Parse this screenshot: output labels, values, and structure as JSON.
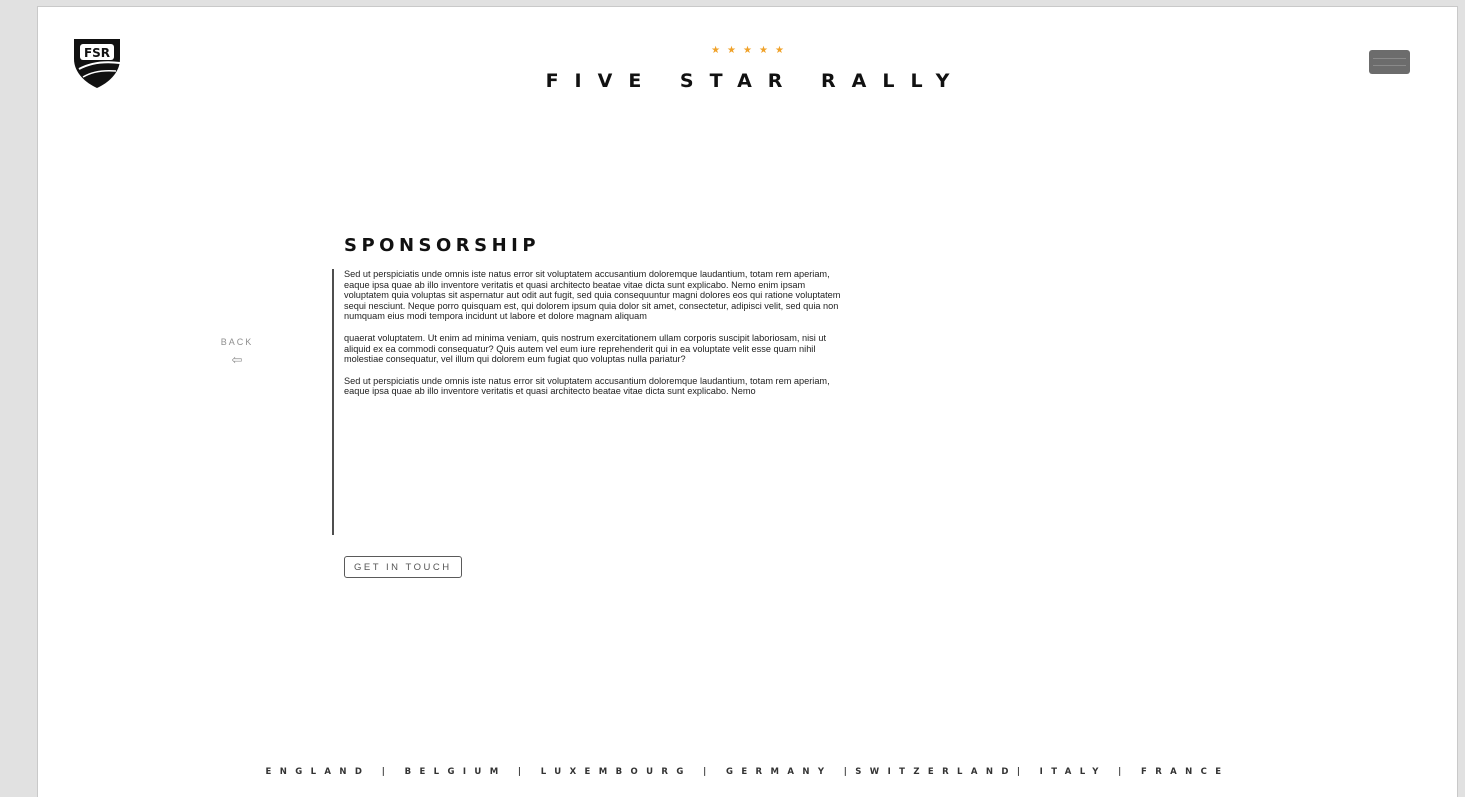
{
  "header": {
    "logo_text": "FSR",
    "stars": "★★★★★",
    "brand_title": "FIVE STAR RALLY",
    "menu_icon": "hamburger-menu-icon"
  },
  "colors": {
    "accent_star": "#f0a22a",
    "page_background": "#ffffff",
    "outer_background": "#e1e1e1",
    "menu_button": "#6c6c6c"
  },
  "nav": {
    "back_label": "BACK",
    "back_arrow": "⇦"
  },
  "main": {
    "title": "SPONSORSHIP",
    "paragraphs": [
      "Sed ut perspiciatis unde omnis iste natus error sit voluptatem accusantium doloremque laudantium, totam rem aperiam, eaque ipsa quae ab illo inventore veritatis et quasi architecto beatae vitae dicta sunt explicabo. Nemo enim ipsam voluptatem quia voluptas sit aspernatur aut odit aut fugit, sed quia consequuntur magni dolores eos qui ratione voluptatem sequi nesciunt. Neque porro quisquam est, qui dolorem ipsum quia dolor sit amet, consectetur, adipisci velit, sed quia non numquam eius modi tempora incidunt ut labore et dolore magnam aliquam",
      "quaerat voluptatem. Ut enim ad minima veniam, quis nostrum exercitationem ullam corporis suscipit laboriosam, nisi ut aliquid ex ea commodi consequatur? Quis autem vel eum iure reprehenderit qui in ea voluptate velit esse quam nihil molestiae consequatur, vel illum qui dolorem eum fugiat quo voluptas nulla pariatur?",
      "Sed ut perspiciatis unde omnis iste natus error sit voluptatem accusantium doloremque laudantium, totam rem aperiam, eaque ipsa quae ab illo inventore veritatis et quasi architecto beatae vitae dicta sunt explicabo. Nemo"
    ],
    "cta_label": "GET IN TOUCH"
  },
  "footer": {
    "countries_line": "ENGLAND | BELGIUM | LUXEMBOURG | GERMANY |SWITZERLAND| ITALY | FRANCE"
  }
}
